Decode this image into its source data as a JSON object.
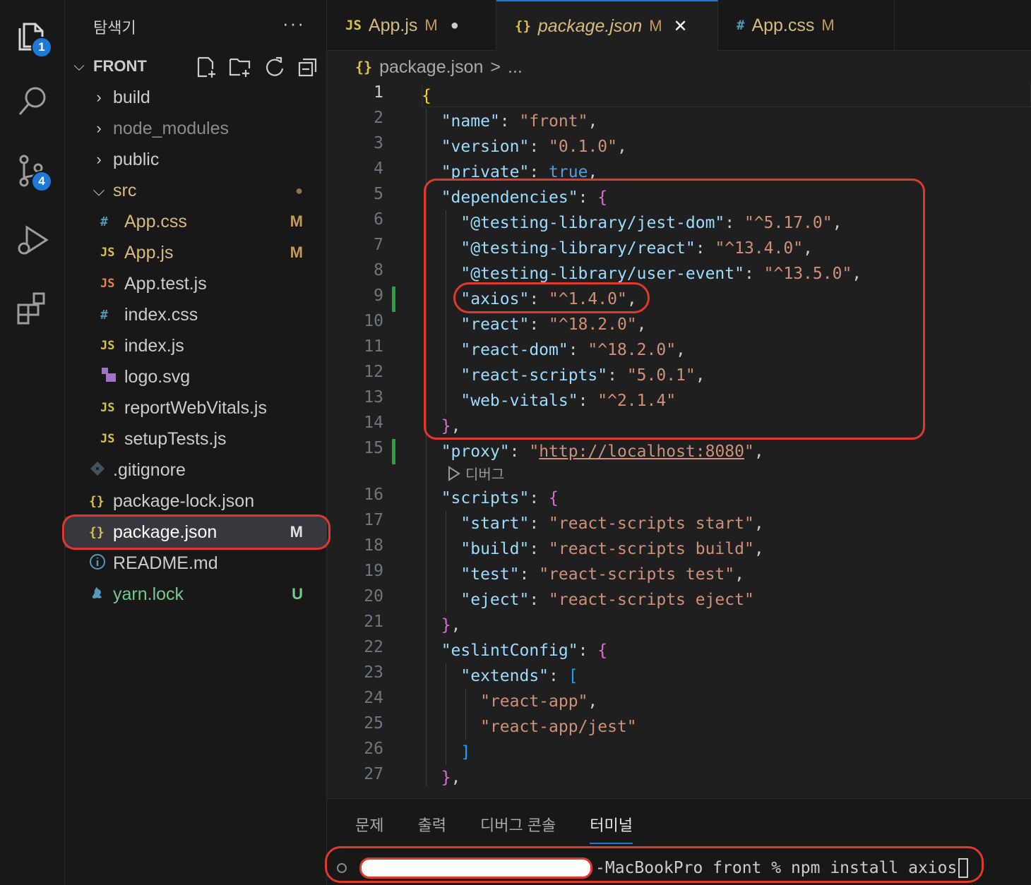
{
  "activity_bar": {
    "items": [
      {
        "icon": "files-icon",
        "badge": "1"
      },
      {
        "icon": "search-icon",
        "badge": ""
      },
      {
        "icon": "source-control-icon",
        "badge": "4"
      },
      {
        "icon": "run-debug-icon",
        "badge": ""
      },
      {
        "icon": "extensions-icon",
        "badge": ""
      }
    ]
  },
  "explorer": {
    "title": "탐색기",
    "more": "···",
    "folder": "FRONT",
    "items": [
      {
        "name": "build",
        "type": "folder",
        "status": ""
      },
      {
        "name": "node_modules",
        "type": "folder",
        "status": ""
      },
      {
        "name": "public",
        "type": "folder",
        "status": ""
      },
      {
        "name": "src",
        "type": "folder-open",
        "status": "●"
      },
      {
        "name": "App.css",
        "icon": "#",
        "status": "M"
      },
      {
        "name": "App.js",
        "icon": "JS",
        "status": "M"
      },
      {
        "name": "App.test.js",
        "icon": "JS",
        "status": ""
      },
      {
        "name": "index.css",
        "icon": "#",
        "status": ""
      },
      {
        "name": "index.js",
        "icon": "JS",
        "status": ""
      },
      {
        "name": "logo.svg",
        "icon": "svg",
        "status": ""
      },
      {
        "name": "reportWebVitals.js",
        "icon": "JS",
        "status": ""
      },
      {
        "name": "setupTests.js",
        "icon": "JS",
        "status": ""
      },
      {
        "name": ".gitignore",
        "icon": "git",
        "status": ""
      },
      {
        "name": "package-lock.json",
        "icon": "{}",
        "status": ""
      },
      {
        "name": "package.json",
        "icon": "{}",
        "status": "M"
      },
      {
        "name": "README.md",
        "icon": "i",
        "status": ""
      },
      {
        "name": "yarn.lock",
        "icon": "yarn",
        "status": "U"
      }
    ]
  },
  "tabs": [
    {
      "icon": "JS",
      "label": "App.js",
      "status": "M",
      "extra": "●"
    },
    {
      "icon": "{}",
      "label": "package.json",
      "status": "M",
      "extra": "✕"
    },
    {
      "icon": "#",
      "label": "App.css",
      "status": "M",
      "extra": ""
    }
  ],
  "breadcrumb": {
    "icon": "{}",
    "file": "package.json",
    "sep": ">",
    "rest": "..."
  },
  "editor": {
    "codelens": "디버그",
    "line_numbers": [
      "1",
      "2",
      "3",
      "4",
      "5",
      "6",
      "7",
      "8",
      "9",
      "10",
      "11",
      "12",
      "13",
      "14",
      "15",
      "16",
      "17",
      "18",
      "19",
      "20",
      "21",
      "22",
      "23",
      "24",
      "25",
      "26",
      "27"
    ],
    "lines": {
      "l1": "{",
      "name_k": "\"name\"",
      "name_v": "\"front\"",
      "version_k": "\"version\"",
      "version_v": "\"0.1.0\"",
      "private_k": "\"private\"",
      "private_v": "true",
      "deps_k": "\"dependencies\"",
      "d1_k": "\"@testing-library/jest-dom\"",
      "d1_v": "\"^5.17.0\"",
      "d2_k": "\"@testing-library/react\"",
      "d2_v": "\"^13.4.0\"",
      "d3_k": "\"@testing-library/user-event\"",
      "d3_v": "\"^13.5.0\"",
      "d4_k": "\"axios\"",
      "d4_v": "\"^1.4.0\"",
      "d5_k": "\"react\"",
      "d5_v": "\"^18.2.0\"",
      "d6_k": "\"react-dom\"",
      "d6_v": "\"^18.2.0\"",
      "d7_k": "\"react-scripts\"",
      "d7_v": "\"5.0.1\"",
      "d8_k": "\"web-vitals\"",
      "d8_v": "\"^2.1.4\"",
      "proxy_k": "\"proxy\"",
      "proxy_v_open": "\"",
      "proxy_url": "http://localhost:8080",
      "proxy_v_close": "\"",
      "scripts_k": "\"scripts\"",
      "s1_k": "\"start\"",
      "s1_v": "\"react-scripts start\"",
      "s2_k": "\"build\"",
      "s2_v": "\"react-scripts build\"",
      "s3_k": "\"test\"",
      "s3_v": "\"react-scripts test\"",
      "s4_k": "\"eject\"",
      "s4_v": "\"react-scripts eject\"",
      "eslint_k": "\"eslintConfig\"",
      "extends_k": "\"extends\"",
      "e1": "\"react-app\"",
      "e2": "\"react-app/jest\""
    }
  },
  "panel": {
    "tabs": [
      "문제",
      "출력",
      "디버그 콘솔",
      "터미널"
    ],
    "active_tab": "터미널",
    "terminal_text": "-MacBookPro front % npm install axios"
  }
}
